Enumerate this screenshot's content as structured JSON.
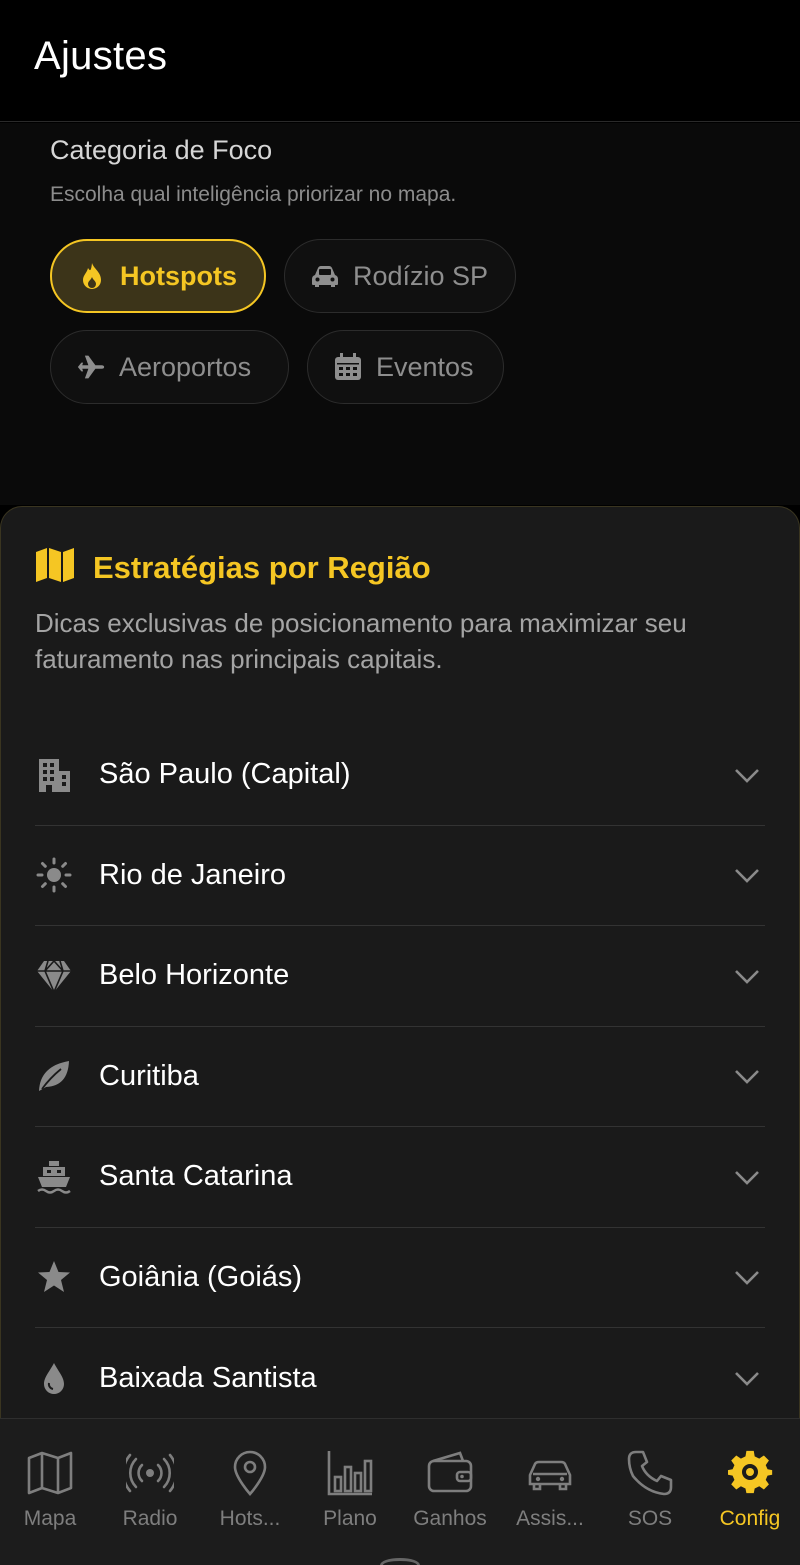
{
  "header": {
    "title": "Ajustes"
  },
  "focus": {
    "title": "Categoria de Foco",
    "subtitle": "Escolha qual inteligência priorizar no mapa.",
    "chips": [
      {
        "label": "Hotspots",
        "icon": "fire-icon",
        "active": true
      },
      {
        "label": "Rodízio SP",
        "icon": "car-icon",
        "active": false
      },
      {
        "label": "Aeroportos",
        "icon": "plane-icon",
        "active": false
      },
      {
        "label": "Eventos",
        "icon": "calendar-icon",
        "active": false
      }
    ]
  },
  "strategies": {
    "title": "Estratégias por Região",
    "icon": "map-icon",
    "description": "Dicas exclusivas de posicionamento para maximizar seu faturamento nas principais capitais.",
    "regions": [
      {
        "label": "São Paulo (Capital)",
        "icon": "building-icon"
      },
      {
        "label": "Rio de Janeiro",
        "icon": "sun-icon"
      },
      {
        "label": "Belo Horizonte",
        "icon": "gem-icon"
      },
      {
        "label": "Curitiba",
        "icon": "leaf-icon"
      },
      {
        "label": "Santa Catarina",
        "icon": "ship-icon"
      },
      {
        "label": "Goiânia (Goiás)",
        "icon": "star-icon"
      },
      {
        "label": "Baixada Santista",
        "icon": "drop-icon"
      }
    ]
  },
  "nav": {
    "items": [
      {
        "label": "Mapa",
        "icon": "map-icon"
      },
      {
        "label": "Radio",
        "icon": "radio-icon"
      },
      {
        "label": "Hots...",
        "icon": "pin-icon"
      },
      {
        "label": "Plano",
        "icon": "bar-chart-icon"
      },
      {
        "label": "Ganhos",
        "icon": "wallet-icon"
      },
      {
        "label": "Assis...",
        "icon": "car-icon"
      },
      {
        "label": "SOS",
        "icon": "phone-icon"
      },
      {
        "label": "Config",
        "icon": "gear-icon",
        "active": true
      }
    ]
  },
  "colors": {
    "accent": "#f5c623",
    "background": "#000000",
    "card": "#1a1a1a",
    "muted": "#7e7e7e"
  }
}
